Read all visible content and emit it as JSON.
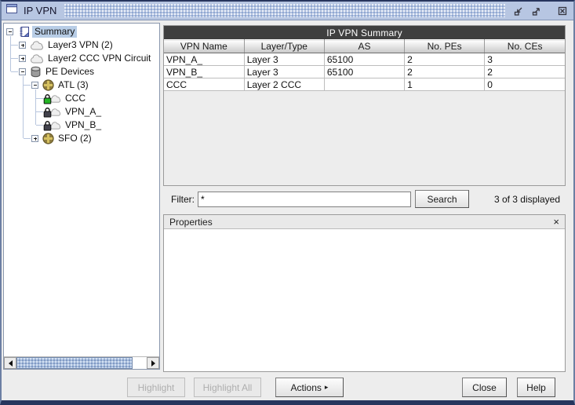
{
  "window": {
    "title": "IP VPN"
  },
  "icons": {
    "window": "window-icon",
    "minimize": "minimize-icon",
    "maximize": "maximize-icon",
    "close": "close-icon"
  },
  "tree": {
    "items": [
      {
        "label": "Summary",
        "level": 0,
        "expander": "minus",
        "icon": "summary-icon",
        "selected": true
      },
      {
        "label": "Layer3 VPN (2)",
        "level": 1,
        "expander": "plus",
        "icon": "cloud-icon",
        "selected": false
      },
      {
        "label": "Layer2 CCC VPN Circuit",
        "level": 1,
        "expander": "plus",
        "icon": "cloud-icon",
        "selected": false
      },
      {
        "label": "PE Devices",
        "level": 1,
        "expander": "minus",
        "icon": "database-icon",
        "selected": false
      },
      {
        "label": "ATL (3)",
        "level": 2,
        "expander": "minus",
        "icon": "router-icon",
        "selected": false
      },
      {
        "label": "CCC",
        "level": 3,
        "expander": null,
        "icon": "lock-green-icon",
        "selected": false
      },
      {
        "label": "VPN_A_",
        "level": 3,
        "expander": null,
        "icon": "lock-dark-icon",
        "selected": false
      },
      {
        "label": "VPN_B_",
        "level": 3,
        "expander": null,
        "icon": "lock-dark-icon",
        "selected": false
      },
      {
        "label": "SFO (2)",
        "level": 2,
        "expander": "plus",
        "icon": "router-icon",
        "selected": false
      }
    ]
  },
  "summary_table": {
    "title": "IP VPN Summary",
    "columns": [
      "VPN Name",
      "Layer/Type",
      "AS",
      "No. PEs",
      "No. CEs"
    ],
    "rows": [
      [
        "VPN_A_",
        "Layer 3",
        "65100",
        "2",
        "3"
      ],
      [
        "VPN_B_",
        "Layer 3",
        "65100",
        "2",
        "2"
      ],
      [
        "CCC",
        "Layer 2 CCC",
        "",
        "1",
        "0"
      ]
    ]
  },
  "filter": {
    "label": "Filter:",
    "value": "*",
    "button": "Search",
    "status": "3 of 3 displayed"
  },
  "properties": {
    "title": "Properties",
    "close": "×"
  },
  "footer": {
    "buttons": [
      {
        "id": "highlight",
        "label": "Highlight",
        "enabled": false
      },
      {
        "id": "highlight-all",
        "label": "Highlight All",
        "enabled": false
      },
      {
        "id": "actions",
        "label": "Actions",
        "arrow": "▸",
        "enabled": true
      },
      {
        "id": "close",
        "label": "Close",
        "enabled": true
      },
      {
        "id": "help",
        "label": "Help",
        "enabled": true
      }
    ]
  },
  "colors": {
    "titlebar": "#b7c6e2",
    "frame": "#9fb1cc",
    "table_title_bg": "#3f3f3f",
    "selection_bg": "#b8cde6",
    "scrollbar_thumb": "#a9bedc"
  }
}
